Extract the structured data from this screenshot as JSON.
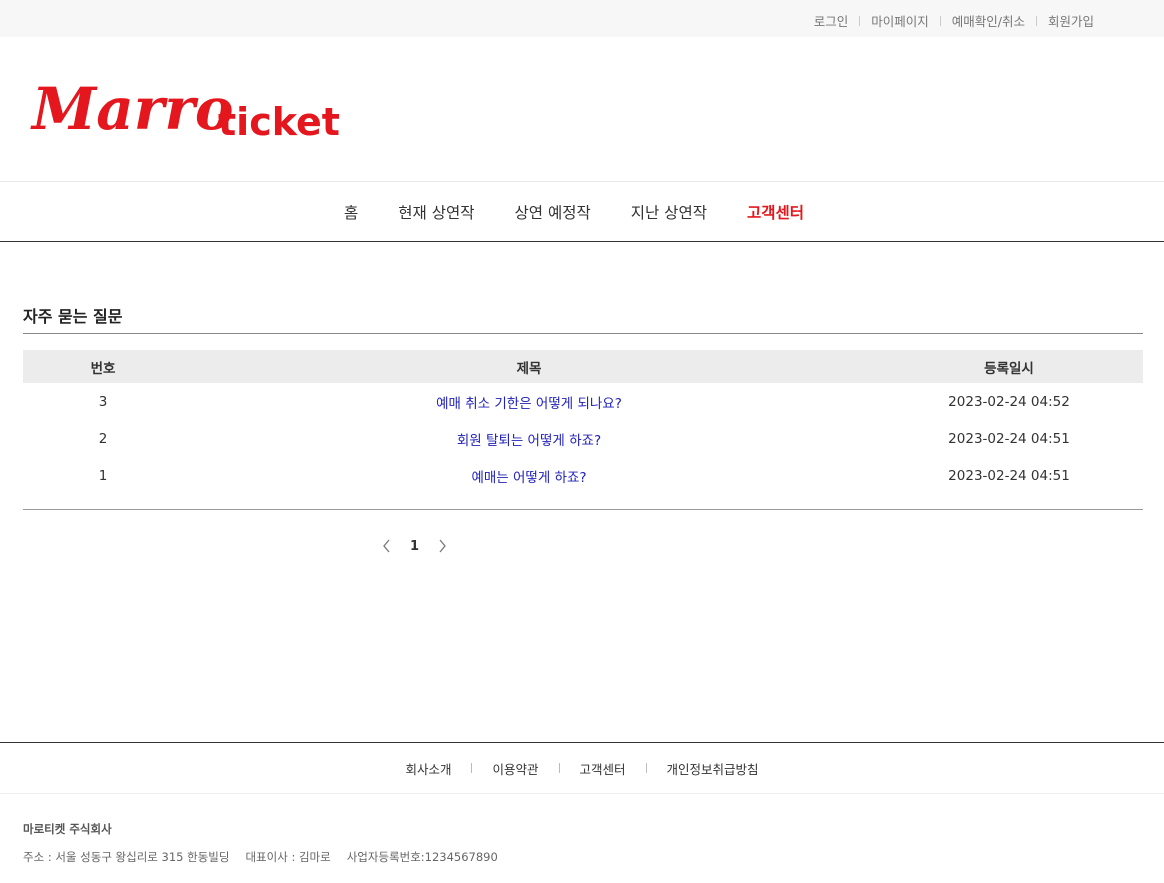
{
  "topbar": {
    "links": [
      "로그인",
      "마이페이지",
      "예매확인/취소",
      "회원가입"
    ]
  },
  "logo": {
    "script_text": "Marro",
    "text": "ticket",
    "color": "#e3171d"
  },
  "gnb": {
    "items": [
      "홈",
      "현재 상연작",
      "상연 예정작",
      "지난 상연작",
      "고객센터"
    ],
    "active": "고객센터",
    "active_color": "#e3171d"
  },
  "faq": {
    "title": "자주 묻는 질문",
    "columns": [
      "번호",
      "제목",
      "등록일시"
    ],
    "rows": [
      {
        "no": "3",
        "subject": "예매 취소 기한은 어떻게 되나요?",
        "date": "2023-02-24 04:52"
      },
      {
        "no": "2",
        "subject": "회원 탈퇴는 어떻게 하죠?",
        "date": "2023-02-24 04:51"
      },
      {
        "no": "1",
        "subject": "예매는 어떻게 하죠?",
        "date": "2023-02-24 04:51"
      }
    ],
    "link_color": "#2222bb"
  },
  "pagination": {
    "current": "1",
    "prev_icon": "chevron-left-icon",
    "next_icon": "chevron-right-icon"
  },
  "footer": {
    "links": [
      "회사소개",
      "이용약관",
      "고객센터",
      "개인정보취급방침"
    ],
    "company_name": "마로티켓 주식회사",
    "address": "주소 : 서울 성동구 왕십리로 315 한동빌딩",
    "ceo": "대표이사 : 김마로",
    "business_no": "사업자등록번호:1234567890"
  }
}
